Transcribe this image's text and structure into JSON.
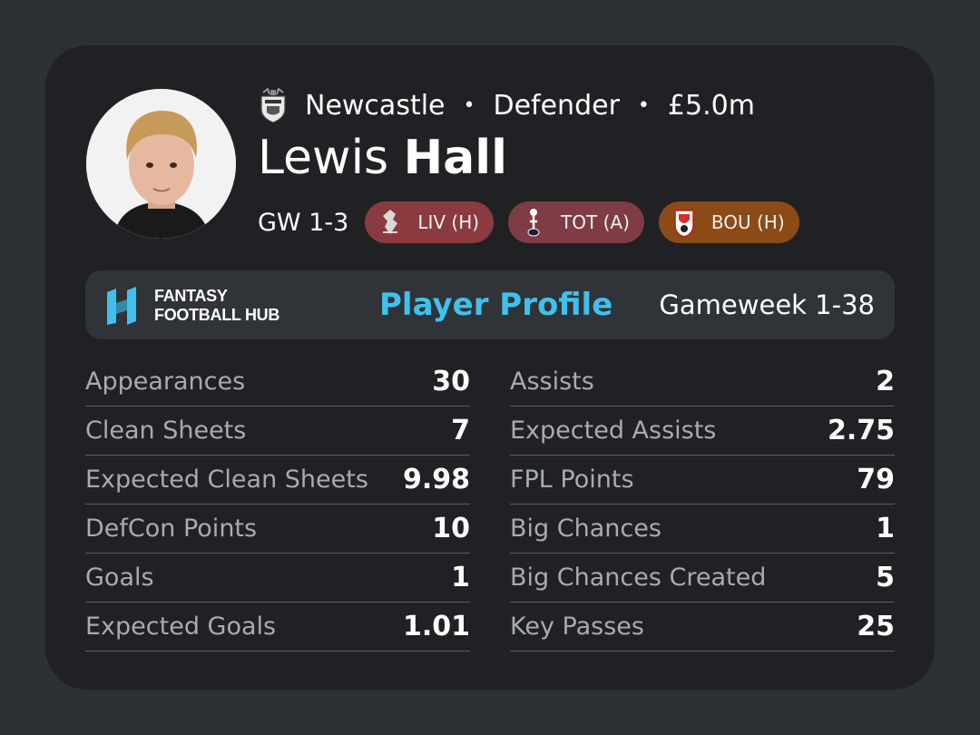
{
  "player": {
    "team": "Newcastle",
    "position": "Defender",
    "price": "£5.0m",
    "separator": "•",
    "first_name": "Lewis",
    "last_name": "Hall"
  },
  "fixtures": {
    "label": "GW 1-3",
    "items": [
      {
        "opponent": "LIV (H)",
        "color": "#8b3a3f",
        "crest_icon": "liverpool-crest-icon"
      },
      {
        "opponent": "TOT (A)",
        "color": "#7f3c44",
        "crest_icon": "tottenham-crest-icon"
      },
      {
        "opponent": "BOU (H)",
        "color": "#8c4a17",
        "crest_icon": "bournemouth-crest-icon"
      }
    ]
  },
  "banner": {
    "brand_line1": "FANTASY",
    "brand_line2": "FOOTBALL HUB",
    "title": "Player Profile",
    "range": "Gameweek 1-38"
  },
  "stats": {
    "left": [
      {
        "label": "Appearances",
        "value": "30"
      },
      {
        "label": "Clean Sheets",
        "value": "7"
      },
      {
        "label": "Expected Clean Sheets",
        "value": "9.98"
      },
      {
        "label": "DefCon Points",
        "value": "10"
      },
      {
        "label": "Goals",
        "value": "1"
      },
      {
        "label": "Expected Goals",
        "value": "1.01"
      }
    ],
    "right": [
      {
        "label": "Assists",
        "value": "2"
      },
      {
        "label": "Expected Assists",
        "value": "2.75"
      },
      {
        "label": "FPL Points",
        "value": "79"
      },
      {
        "label": "Big Chances",
        "value": "1"
      },
      {
        "label": "Big Chances Created",
        "value": "5"
      },
      {
        "label": "Key Passes",
        "value": "25"
      }
    ]
  },
  "colors": {
    "accent": "#3fc1ec",
    "card": "#1f2124",
    "background": "#2d3034"
  }
}
